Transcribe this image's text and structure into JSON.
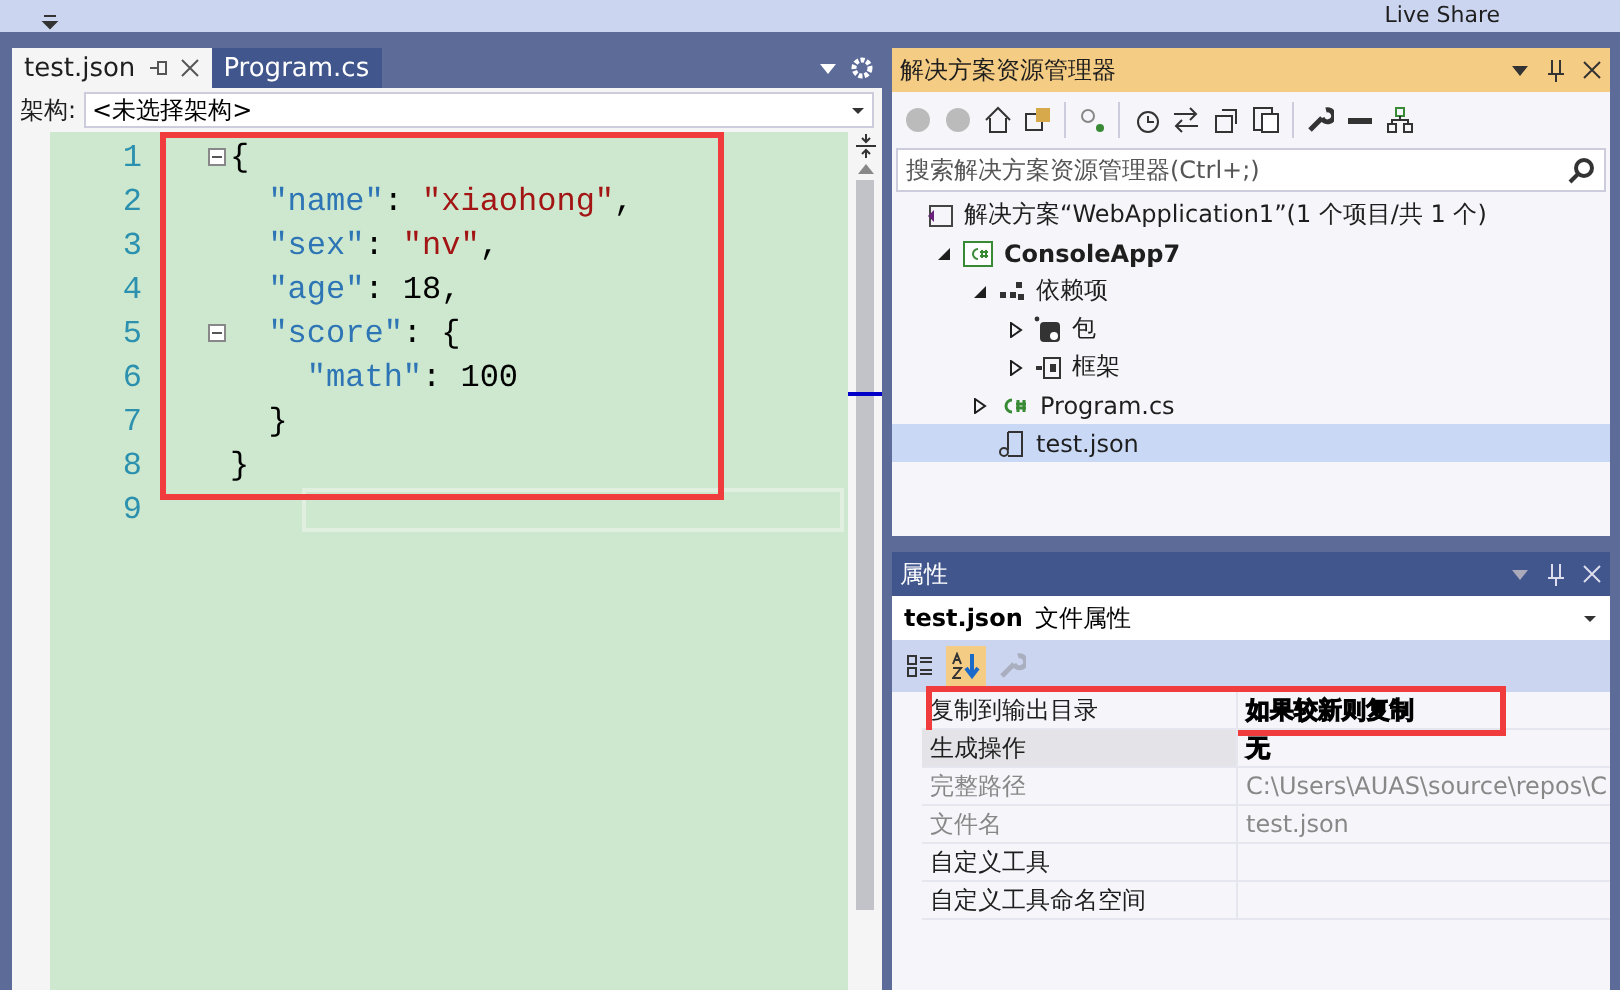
{
  "top_bar": {
    "live_share": "Live Share"
  },
  "editor": {
    "tabs": [
      {
        "label": "test.json",
        "selected": true
      },
      {
        "label": "Program.cs",
        "selected": false
      }
    ],
    "schema_label": "架构:",
    "schema_value": "<未选择架构>",
    "highlighted": true,
    "lines": [
      {
        "number": "1",
        "fold_expanded": true,
        "tokens": [
          {
            "kind": "punct",
            "text": "{"
          }
        ]
      },
      {
        "number": "2",
        "tokens": [
          {
            "kind": "key",
            "text": "\"name\""
          },
          {
            "kind": "punct",
            "text": ": "
          },
          {
            "kind": "string",
            "text": "\"xiaohong\""
          },
          {
            "kind": "punct",
            "text": ","
          }
        ]
      },
      {
        "number": "3",
        "tokens": [
          {
            "kind": "key",
            "text": "\"sex\""
          },
          {
            "kind": "punct",
            "text": ": "
          },
          {
            "kind": "string",
            "text": "\"nv\""
          },
          {
            "kind": "punct",
            "text": ","
          }
        ]
      },
      {
        "number": "4",
        "tokens": [
          {
            "kind": "key",
            "text": "\"age\""
          },
          {
            "kind": "punct",
            "text": ": "
          },
          {
            "kind": "number",
            "text": "18"
          },
          {
            "kind": "punct",
            "text": ","
          }
        ]
      },
      {
        "number": "5",
        "fold_expanded": true,
        "tokens": [
          {
            "kind": "key",
            "text": "\"score\""
          },
          {
            "kind": "punct",
            "text": ": {"
          }
        ]
      },
      {
        "number": "6",
        "tokens": [
          {
            "kind": "key",
            "text": "\"math\""
          },
          {
            "kind": "punct",
            "text": ": "
          },
          {
            "kind": "number",
            "text": "100"
          }
        ]
      },
      {
        "number": "7",
        "tokens": [
          {
            "kind": "punct",
            "text": "}"
          }
        ]
      },
      {
        "number": "8",
        "tokens": [
          {
            "kind": "punct",
            "text": "}"
          }
        ]
      },
      {
        "number": "9"
      }
    ]
  },
  "solution_explorer": {
    "title": "解决方案资源管理器",
    "search": {
      "placeholder": "搜索解决方案资源管理器(Ctrl+;)"
    },
    "tree": [
      {
        "label": "解决方案“WebApplication1”(1 个项目/共 1 个)",
        "kind": "solution",
        "selected": false,
        "children": [
          {
            "label": "ConsoleApp7",
            "kind": "project",
            "selected": false,
            "expanded": true,
            "children": [
              {
                "label": "依赖项",
                "kind": "dependencies",
                "selected": false,
                "expanded": true,
                "children": [
                  {
                    "label": "包",
                    "kind": "package",
                    "selected": false,
                    "expanded": false
                  },
                  {
                    "label": "框架",
                    "kind": "framework",
                    "selected": false,
                    "expanded": false
                  }
                ]
              },
              {
                "label": "Program.cs",
                "kind": "csfile",
                "selected": false,
                "expanded": false
              },
              {
                "label": "test.json",
                "kind": "jsonfile",
                "selected": true
              }
            ]
          }
        ]
      }
    ]
  },
  "properties": {
    "title": "属性",
    "object_name": "test.json",
    "object_type": "文件属性",
    "tools": [
      {
        "kind": "categorized",
        "selected": false,
        "disabled": false
      },
      {
        "kind": "alphabetical",
        "selected": true,
        "disabled": false
      },
      {
        "kind": "pages",
        "selected": false,
        "disabled": true
      }
    ],
    "rows": [
      {
        "name": "复制到输出目录",
        "value": "如果较新则复制",
        "bold": true,
        "readonly": false,
        "selected": false,
        "highlighted": true
      },
      {
        "name": "生成操作",
        "value": "无",
        "bold": true,
        "readonly": false,
        "selected": true,
        "highlighted": false
      },
      {
        "name": "完整路径",
        "value": "C:\\Users\\AUAS\\source\\repos\\C",
        "bold": false,
        "readonly": true,
        "selected": false,
        "highlighted": false
      },
      {
        "name": "文件名",
        "value": "test.json",
        "bold": false,
        "readonly": true,
        "selected": false,
        "highlighted": false
      },
      {
        "name": "自定义工具",
        "readonly": false,
        "selected": false,
        "highlighted": false
      },
      {
        "name": "自定义工具命名空间",
        "readonly": false,
        "selected": false,
        "highlighted": false
      }
    ]
  }
}
